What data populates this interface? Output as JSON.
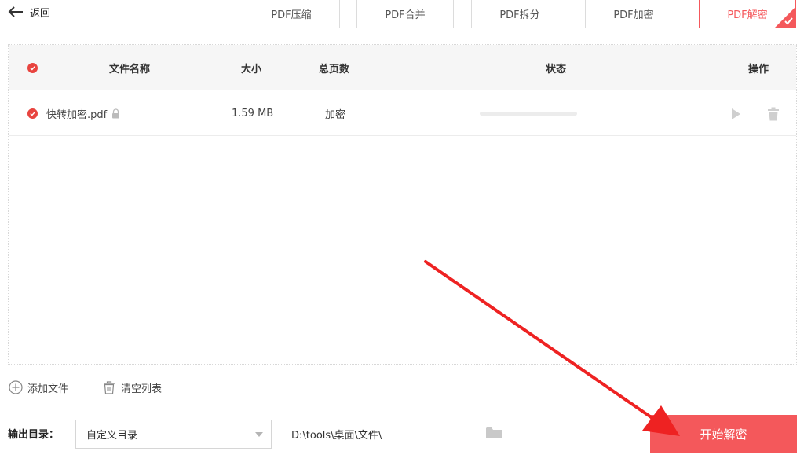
{
  "header": {
    "back_label": "返回",
    "tabs": [
      {
        "label": "PDF压缩"
      },
      {
        "label": "PDF合并"
      },
      {
        "label": "PDF拆分"
      },
      {
        "label": "PDF加密"
      },
      {
        "label": "PDF解密"
      }
    ],
    "active_tab": "PDF解密"
  },
  "table": {
    "columns": {
      "name": "文件名称",
      "size": "大小",
      "pages": "总页数",
      "status": "状态",
      "actions": "操作"
    },
    "rows": [
      {
        "name": "快转加密.pdf",
        "size": "1.59 MB",
        "pages": "加密",
        "progress": 0
      }
    ]
  },
  "tools": {
    "add_file": "添加文件",
    "clear_list": "清空列表"
  },
  "output": {
    "label": "输出目录：",
    "select_value": "自定义目录",
    "path": "D:\\tools\\桌面\\文件\\"
  },
  "start_button": "开始解密",
  "colors": {
    "accent": "#f4585b",
    "check": "#e8443f",
    "annotation_arrow": "#ee2222"
  },
  "icons": [
    "back-arrow-icon",
    "check-circle-icon",
    "lock-icon",
    "play-icon",
    "trash-icon",
    "add-circle-icon",
    "folder-icon",
    "caret-down-icon"
  ]
}
